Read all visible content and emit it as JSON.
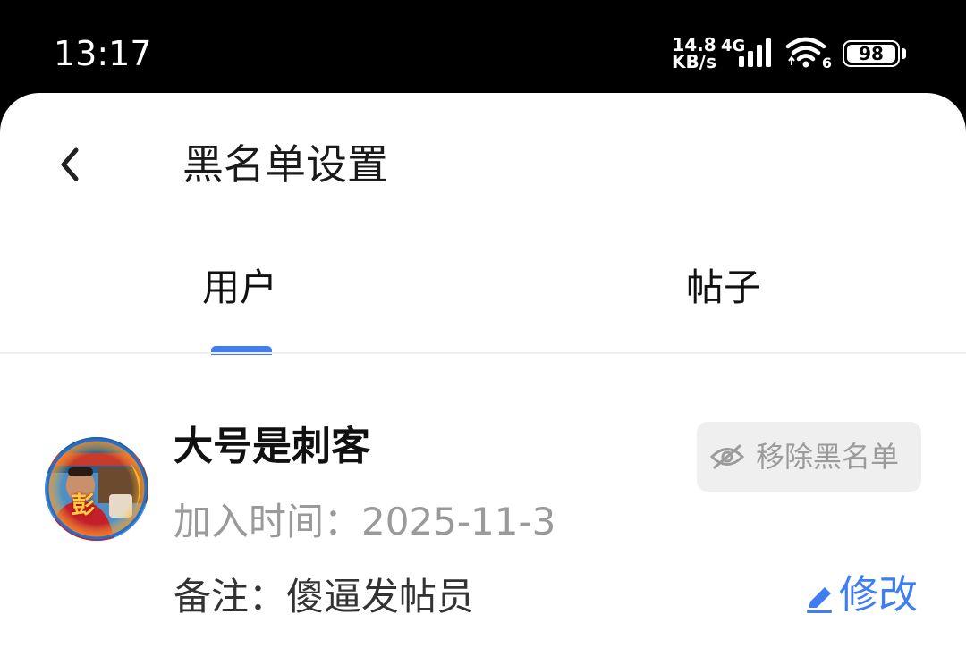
{
  "status_bar": {
    "time": "13:17",
    "net_speed_value": "14.8",
    "net_speed_unit": "KB/s",
    "network_type": "4G",
    "wifi_standard": "6",
    "battery_level": "98",
    "signal_bars_filled": 4
  },
  "header": {
    "title": "黑名单设置"
  },
  "tabs": [
    {
      "label": "用户",
      "active": true
    },
    {
      "label": "帖子",
      "active": false
    }
  ],
  "colors": {
    "accent": "#3f7df2",
    "muted_text": "#9a9a9a",
    "button_bg": "#efefef"
  },
  "blacklist": [
    {
      "name": "大号是刺客",
      "join_time": "加入时间：2025-11-3",
      "remark": "备注：傻逼发帖员",
      "avatar_text": "彭",
      "remove_label": "移除黑名单",
      "remove_icon": "eye-off-icon",
      "edit_label": "修改",
      "edit_icon": "pencil-icon"
    }
  ]
}
